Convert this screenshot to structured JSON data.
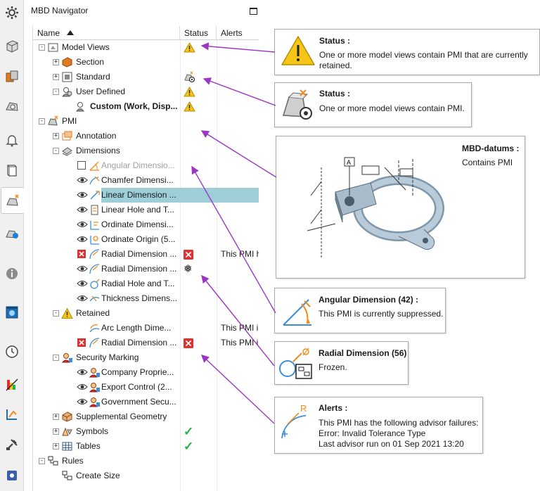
{
  "navigator": {
    "title": "MBD Navigator",
    "columns": {
      "name": "Name",
      "status": "Status",
      "alerts": "Alerts"
    }
  },
  "tree": [
    {
      "label": "Model Views",
      "icon": "model-views-icon",
      "expander": "-",
      "status": "warning"
    },
    {
      "label": "Section",
      "icon": "section-view-icon",
      "expander": "+"
    },
    {
      "label": "Standard",
      "icon": "standard-view-icon",
      "expander": "+",
      "status": "pmi-gear"
    },
    {
      "label": "User Defined",
      "icon": "user-defined-icon",
      "expander": "-",
      "status": "warning"
    },
    {
      "label": "Custom (Work, Disp...",
      "icon": "custom-view-icon",
      "bold": true,
      "status": "warning"
    },
    {
      "label": "PMI",
      "icon": "pmi-icon",
      "expander": "-"
    },
    {
      "label": "Annotation",
      "icon": "annotation-icon",
      "expander": "+"
    },
    {
      "label": "Dimensions",
      "icon": "dimensions-icon",
      "expander": "-"
    },
    {
      "label": "Angular Dimensio...",
      "icon": "angular-dimension-icon",
      "suppressed": true
    },
    {
      "label": "Chamfer Dimensi...",
      "icon": "chamfer-dimension-icon"
    },
    {
      "label": "Linear Dimension ...",
      "icon": "linear-dimension-icon",
      "selected": true
    },
    {
      "label": "Linear Hole and T...",
      "icon": "linear-hole-icon"
    },
    {
      "label": "Ordinate Dimensi...",
      "icon": "ordinate-dimension-icon"
    },
    {
      "label": "Ordinate Origin (5...",
      "icon": "ordinate-origin-icon"
    },
    {
      "label": "Radial Dimension ...",
      "icon": "radial-dimension-icon",
      "status": "error",
      "alert": "This PMI h"
    },
    {
      "label": "Radial Dimension ...",
      "icon": "radial-dimension-icon",
      "status": "frozen"
    },
    {
      "label": "Radial Hole and T...",
      "icon": "radial-hole-icon"
    },
    {
      "label": "Thickness Dimens...",
      "icon": "thickness-dimension-icon"
    },
    {
      "label": "Retained",
      "icon": "retained-warning-icon",
      "expander": "-"
    },
    {
      "label": "Arc Length Dime...",
      "icon": "arc-length-icon",
      "alert": "This PMI i"
    },
    {
      "label": "Radial Dimension ...",
      "icon": "radial-dimension-icon",
      "status": "error",
      "alert": "This PMI i"
    },
    {
      "label": "Security Marking",
      "icon": "security-marking-icon",
      "expander": "-"
    },
    {
      "label": "Company Proprie...",
      "icon": "security-marking-icon"
    },
    {
      "label": "Export Control (2...",
      "icon": "security-marking-icon"
    },
    {
      "label": "Government Secu...",
      "icon": "security-marking-icon"
    },
    {
      "label": "Supplemental Geometry",
      "icon": "supplemental-geometry-icon",
      "expander": "+"
    },
    {
      "label": "Symbols",
      "icon": "symbols-icon",
      "expander": "+",
      "status": "ok"
    },
    {
      "label": "Tables",
      "icon": "tables-icon",
      "expander": "+",
      "status": "ok"
    },
    {
      "label": "Rules",
      "icon": "rules-icon",
      "expander": "-"
    },
    {
      "label": "Create Size",
      "icon": "create-size-icon"
    }
  ],
  "callouts": {
    "status_warning": {
      "title": "Status :",
      "body": "One or more model views contain PMI that are currently retained."
    },
    "status_pmi": {
      "title": "Status :",
      "body": "One or more model views contain PMI."
    },
    "mbd_datums": {
      "title": "MBD-datums :",
      "body": "Contains PMI"
    },
    "angular": {
      "title": "Angular Dimension (42) :",
      "body": "This PMI is currently suppressed."
    },
    "radial": {
      "title": "Radial Dimension (56)",
      "body": "Frozen."
    },
    "alerts": {
      "title": "Alerts :",
      "line1": "This PMI has the following advisor failures:",
      "line2": "Error: Invalid Tolerance Type",
      "line3": "Last advisor run on 01 Sep 2021 13:20",
      "glyph": "R"
    }
  },
  "colors": {
    "arrow": "#9b35c4",
    "selection": "#9ecfd9",
    "warning": "#f5c518",
    "error": "#e03030",
    "ok": "#22b14c",
    "accent_orange": "#f08c1a"
  },
  "toolbar": [
    "settings-icon",
    "part-icon",
    "assembly-icon",
    "constraint-icon",
    "bell-icon",
    "book-icon",
    "mbd-navigator-icon",
    "pmi-tools-icon",
    "info-icon",
    "browser-icon",
    "clock-icon",
    "analysis-icon",
    "reuse-icon",
    "tools-icon",
    "roles-icon"
  ]
}
